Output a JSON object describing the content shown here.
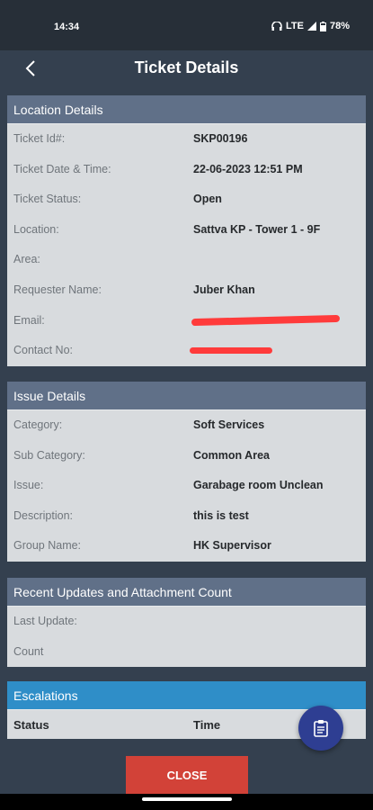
{
  "status": {
    "time": "14:34",
    "network": "LTE",
    "battery": "78%"
  },
  "header": {
    "title": "Ticket Details"
  },
  "location": {
    "heading": "Location Details",
    "rows": [
      {
        "label": "Ticket Id#:",
        "value": "SKP00196"
      },
      {
        "label": "Ticket Date & Time:",
        "value": "22-06-2023 12:51 PM"
      },
      {
        "label": "Ticket Status:",
        "value": "Open"
      },
      {
        "label": "Location:",
        "value": "Sattva KP - Tower 1 - 9F"
      },
      {
        "label": "Area:",
        "value": ""
      },
      {
        "label": "Requester Name:",
        "value": "Juber Khan"
      },
      {
        "label": "Email:",
        "value": ""
      },
      {
        "label": "Contact No:",
        "value": ""
      }
    ]
  },
  "issue": {
    "heading": "Issue Details",
    "rows": [
      {
        "label": "Category:",
        "value": "Soft Services"
      },
      {
        "label": "Sub Category:",
        "value": "Common Area"
      },
      {
        "label": "Issue:",
        "value": "Garabage room Unclean"
      },
      {
        "label": "Description:",
        "value": "this is test"
      },
      {
        "label": "Group Name:",
        "value": "HK Supervisor"
      }
    ]
  },
  "updates": {
    "heading": "Recent Updates and Attachment Count",
    "rows": [
      {
        "label": "Last Update:",
        "value": ""
      },
      {
        "label": "Count",
        "value": ""
      }
    ]
  },
  "escalations": {
    "heading": "Escalations",
    "columns": [
      "Status",
      "Time"
    ]
  },
  "actions": {
    "close_label": "CLOSE"
  },
  "colors": {
    "card_header": "#607088",
    "escalation_header": "#2f8ec8",
    "close_button": "#d24238",
    "fab": "#2e3e92"
  },
  "icons": {
    "back": "chevron-left-icon",
    "fab": "clipboard-icon"
  }
}
